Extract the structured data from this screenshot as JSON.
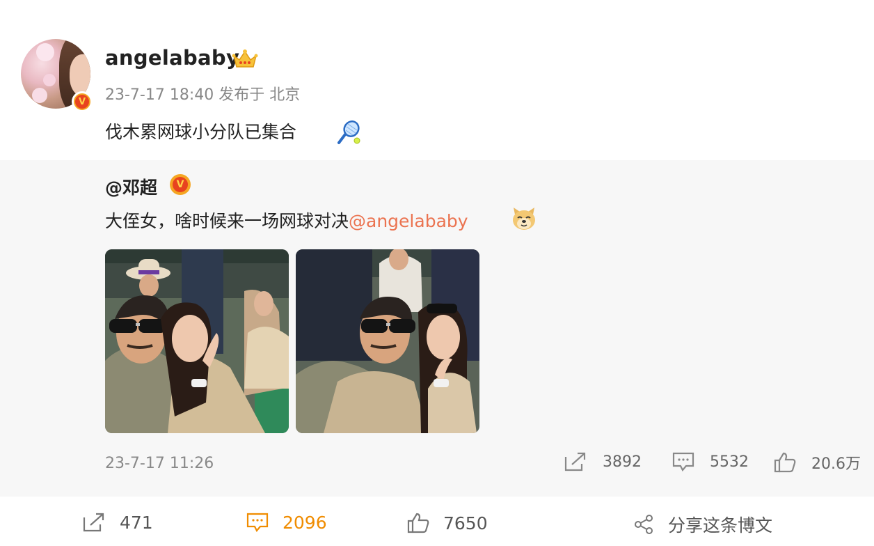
{
  "post": {
    "username": "angelababy",
    "time": "23-7-17 18:40",
    "location": "发布于 北京",
    "text": "伐木累网球小分队已集合",
    "verified_icon": "v-badge-icon",
    "title_icon": "crown-icon",
    "emoji_icon": "tennis-racket-icon"
  },
  "repost": {
    "username": "@邓超",
    "verified_icon": "v-badge-icon",
    "text": "大侄女，啥时候来一场网球对决",
    "mention": "@angelababy",
    "emoji_icon": "doge-icon",
    "time": "23-7-17 11:26",
    "shares": "3892",
    "comments": "5532",
    "likes": "20.6万"
  },
  "footer": {
    "shares": "471",
    "comments": "2096",
    "likes": "7650",
    "share_label": "分享这条博文"
  },
  "colors": {
    "accent": "#f08c00",
    "mention": "#eb7350",
    "meta": "#888888"
  }
}
